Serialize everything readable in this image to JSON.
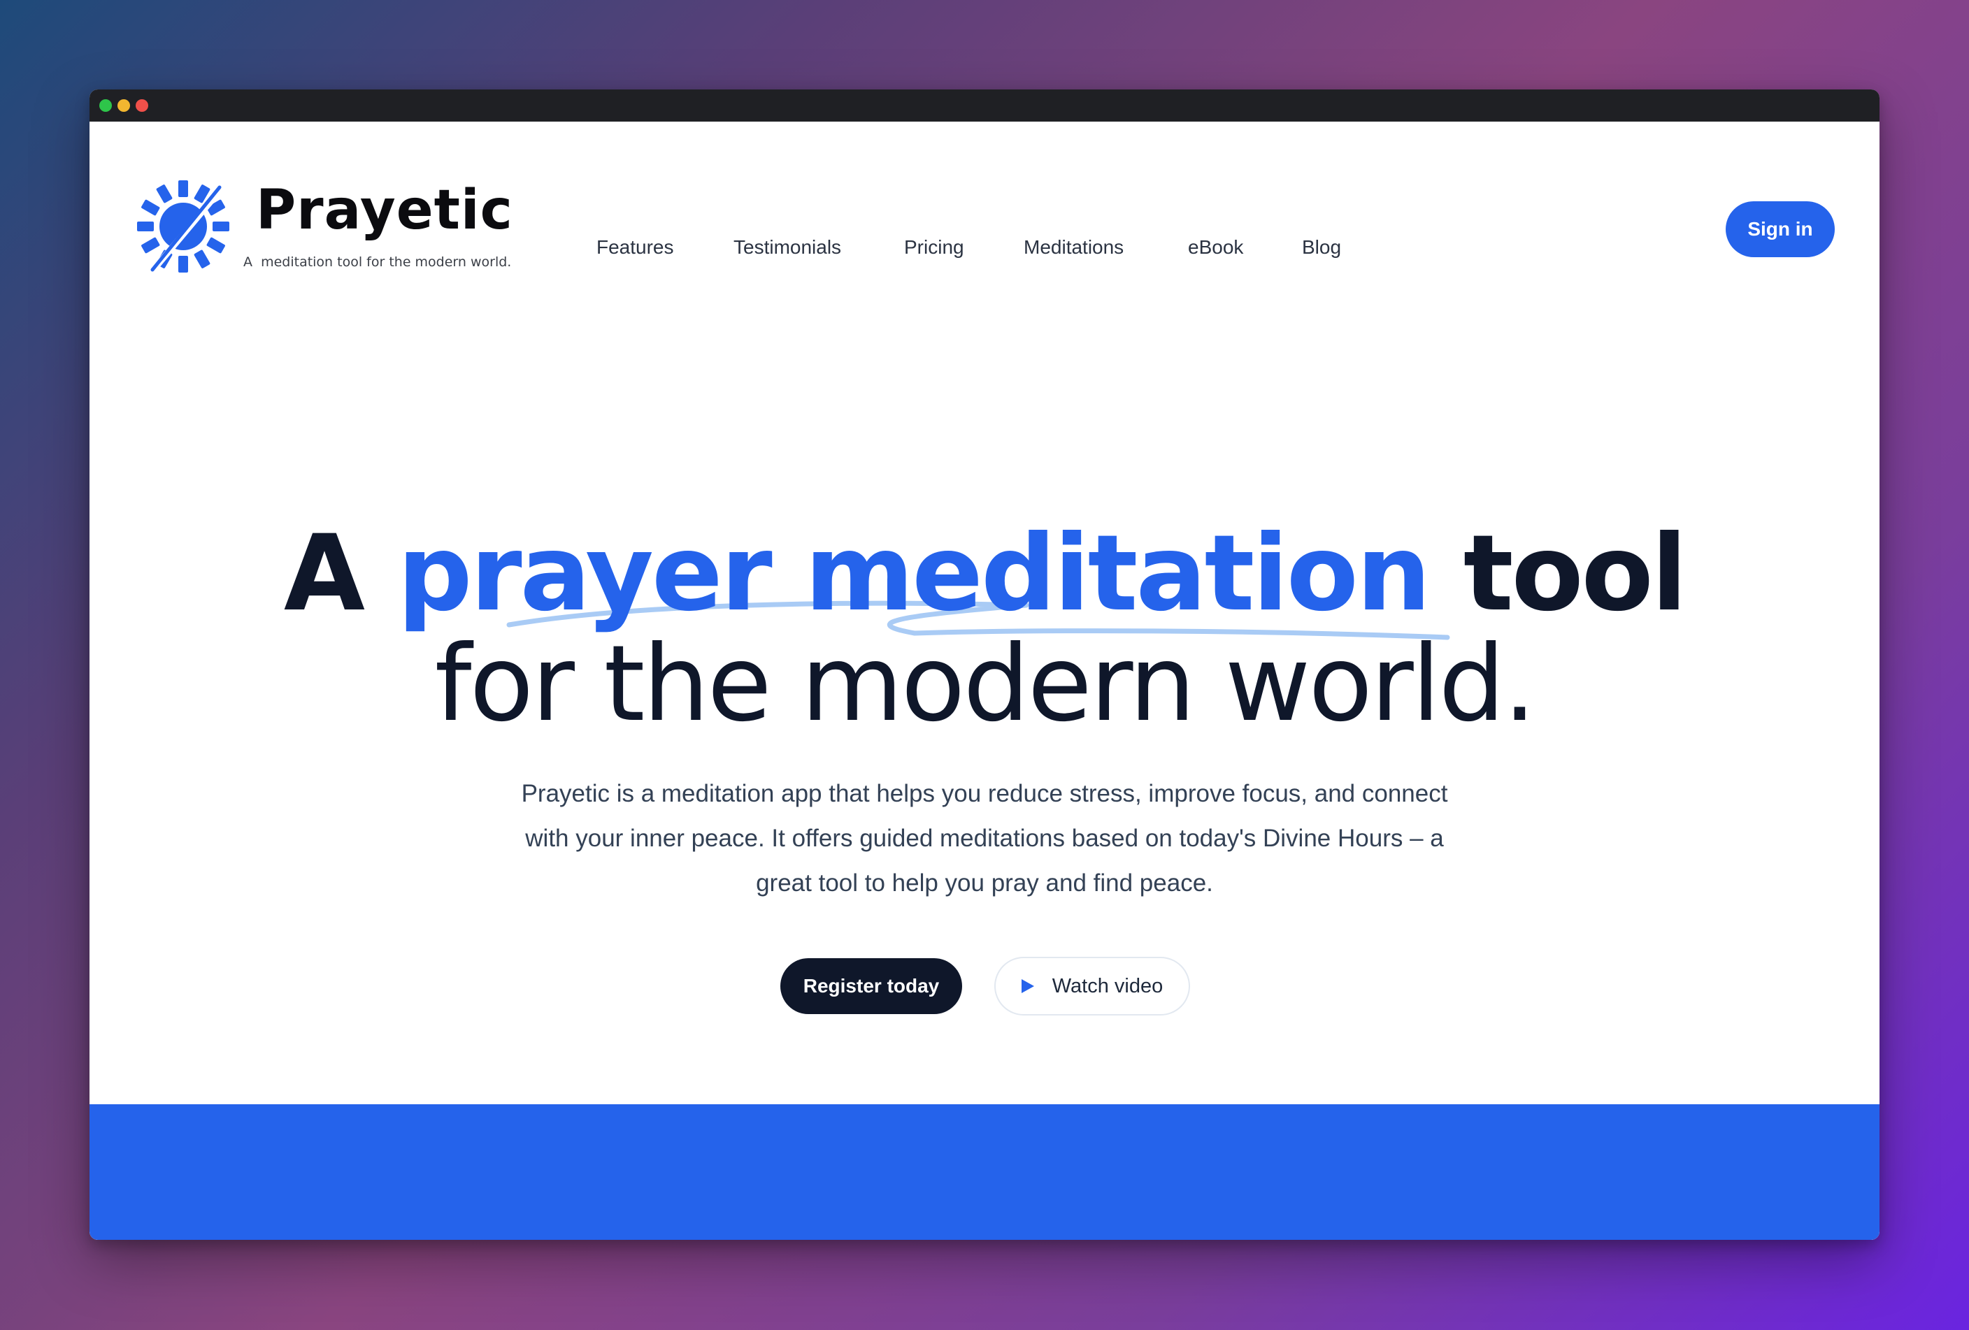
{
  "brand": {
    "name": "Prayetic",
    "tagline": "A  meditation tool for the modern world."
  },
  "nav": {
    "links": [
      "Features",
      "Testimonials",
      "Pricing",
      "Meditations",
      "eBook",
      "Blog"
    ],
    "sign_in": "Sign in"
  },
  "hero": {
    "title_prefix": "A",
    "title_highlight": "prayer meditation",
    "title_suffix": "tool",
    "title_line2": "for the modern world.",
    "description": "Prayetic is a meditation app that helps you reduce stress, improve focus, and connect with your inner peace. It offers guided meditations based on today's Divine Hours – a great tool to help you pray and find peace.",
    "register_label": "Register today",
    "watch_label": "Watch video"
  },
  "colors": {
    "accent": "#2563eb",
    "dark": "#0f172a",
    "squiggle": "#a9cbf5"
  },
  "icons": {
    "logo": "sun-compass-logo-icon",
    "watch": "play-icon"
  }
}
